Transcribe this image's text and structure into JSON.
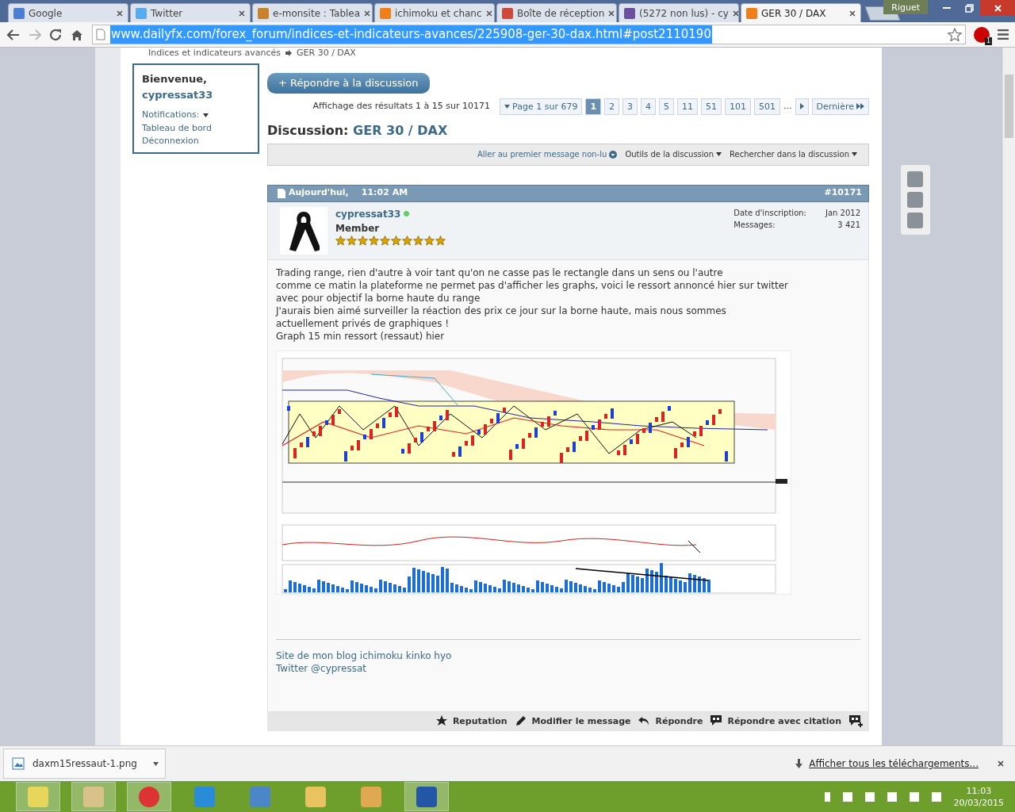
{
  "browser": {
    "tabs": [
      {
        "title": "Google",
        "selected": false,
        "color": "#4a7fd6"
      },
      {
        "title": "Twitter",
        "selected": false,
        "color": "#55acee"
      },
      {
        "title": "e-monsite : Tablea",
        "selected": false,
        "color": "#c9822b"
      },
      {
        "title": "ichimoku et chanc",
        "selected": false,
        "color": "#f07f1a"
      },
      {
        "title": "Boîte de réception",
        "selected": false,
        "color": "#d14836"
      },
      {
        "title": "(5272 non lus) - cy",
        "selected": false,
        "color": "#6b4fa0"
      },
      {
        "title": "GER 30 / DAX",
        "selected": true,
        "color": "#f07f1a"
      }
    ],
    "profile": "Riguet",
    "url": "www.dailyfx.com/forex_forum/indices-et-indicateurs-avances/225908-ger-30-dax.html#post2110190",
    "extension_badge": "1"
  },
  "breadcrumb": [
    "Indices et indicateurs avancés",
    "GER 30 / DAX"
  ],
  "welcome": {
    "greeting": "Bienvenue,",
    "user": "cypressat33",
    "links": [
      "Notifications:",
      "Tableau de bord",
      "Déconnexion"
    ]
  },
  "reply_button": "+ Répondre à la discussion",
  "results": "Affichage des résultats 1 à 15 sur 10171",
  "page_select": "Page 1 sur 679",
  "pages": [
    {
      "label": "1",
      "selected": true
    },
    {
      "label": "2",
      "selected": false
    },
    {
      "label": "3",
      "selected": false
    },
    {
      "label": "4",
      "selected": false
    },
    {
      "label": "5",
      "selected": false
    },
    {
      "label": "11",
      "selected": false
    },
    {
      "label": "51",
      "selected": false
    },
    {
      "label": "101",
      "selected": false
    },
    {
      "label": "501",
      "selected": false
    }
  ],
  "ellipsis": "...",
  "last_page": "Dernière",
  "discussion": {
    "label": "Discussion:",
    "title": "GER 30 / DAX"
  },
  "tools": [
    "Aller au premier message non-lu",
    "Outils de la discussion",
    "Rechercher dans la discussion"
  ],
  "post": {
    "day": "Aujourd'hui,",
    "time": "11:02 AM",
    "number": "#10171",
    "author": "cypressat33",
    "online": true,
    "rank": "Member",
    "stars": 10,
    "stats": [
      {
        "label": "Date d'inscription:",
        "value": "Jan 2012"
      },
      {
        "label": "Messages:",
        "value": "3 421"
      }
    ],
    "lines": [
      "Trading range, rien d'autre à voir tant qu'on ne casse pas le rectangle dans un sens ou l'autre",
      "comme ce matin la plateforme ne permet pas d'afficher les graphs, voici le ressort annoncé hier sur twitter",
      "avec pour objectif la borne haute du range",
      "J'aurais bien aimé surveiller la réaction des prix ce jour sur la borne haute, mais nous sommes",
      "actuellement privés de graphiques !",
      "Graph 15 min ressort (ressaut) hier"
    ],
    "signature": [
      "Site de mon blog ichimoku kinko hyo",
      "Twitter @cypressat"
    ],
    "actions": [
      {
        "kind": "star",
        "label": "Reputation"
      },
      {
        "kind": "pencil",
        "label": "Modifier le message"
      },
      {
        "kind": "reply",
        "label": "Répondre"
      },
      {
        "kind": "quote",
        "label": "Répondre avec citation"
      },
      {
        "kind": "multiquote"
      }
    ]
  },
  "download": {
    "file": "daxm15ressaut-1.png",
    "show_all": "Afficher tous les téléchargements..."
  },
  "clock": {
    "time": "11:03",
    "date": "20/03/2015"
  }
}
